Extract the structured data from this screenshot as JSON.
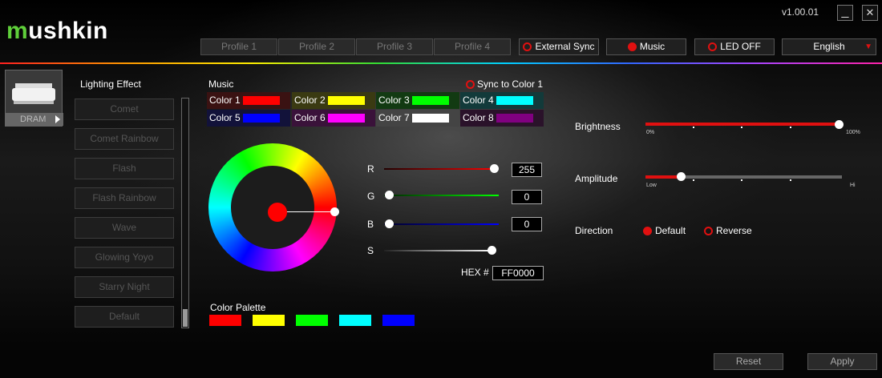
{
  "app": {
    "logo_m": "m",
    "logo_rest": "ushkin",
    "version": "v1.00.01"
  },
  "window": {
    "minimize": "_",
    "close": "✕"
  },
  "profiles": [
    "Profile 1",
    "Profile 2",
    "Profile 3",
    "Profile 4"
  ],
  "toolbar": {
    "external_sync": "External Sync",
    "music": "Music",
    "led_off": "LED OFF",
    "language": "English",
    "language_arrow": "▼"
  },
  "device": {
    "label": "DRAM"
  },
  "lighting": {
    "title": "Lighting Effect",
    "effects": [
      "Comet",
      "Comet Rainbow",
      "Flash",
      "Flash Rainbow",
      "Wave",
      "Glowing Yoyo",
      "Starry Night",
      "Default"
    ]
  },
  "music": {
    "title": "Music",
    "sync_label": "Sync to Color 1",
    "colors": [
      {
        "label": "Color 1",
        "color": "#ff0000",
        "bg": "#3a1212"
      },
      {
        "label": "Color 2",
        "color": "#ffff00",
        "bg": "#3a3a12"
      },
      {
        "label": "Color 3",
        "color": "#00ff00",
        "bg": "#123a12"
      },
      {
        "label": "Color 4",
        "color": "#00ffff",
        "bg": "#123a3a"
      },
      {
        "label": "Color 5",
        "color": "#0000ff",
        "bg": "#12123a"
      },
      {
        "label": "Color 6",
        "color": "#ff00ff",
        "bg": "#3a123a"
      },
      {
        "label": "Color 7",
        "color": "#ffffff",
        "bg": "#444444"
      },
      {
        "label": "Color 8",
        "color": "#800080",
        "bg": "#2a122a"
      }
    ]
  },
  "rgb": {
    "r_label": "R",
    "r_value": "255",
    "g_label": "G",
    "g_value": "0",
    "b_label": "B",
    "b_value": "0",
    "s_label": "S",
    "hex_label": "HEX #",
    "hex_value": "FF0000"
  },
  "palette": {
    "title": "Color Palette",
    "colors": [
      "#ff0000",
      "#ffff00",
      "#00ff00",
      "#00ffff",
      "#0000ff"
    ]
  },
  "brightness": {
    "label": "Brightness",
    "min": "0%",
    "max": "100%",
    "value": 1.0
  },
  "amplitude": {
    "label": "Amplitude",
    "min": "Low",
    "max": "Hi",
    "value": 0.18
  },
  "direction": {
    "label": "Direction",
    "default": "Default",
    "reverse": "Reverse",
    "selected": "Default"
  },
  "footer": {
    "reset": "Reset",
    "apply": "Apply"
  }
}
